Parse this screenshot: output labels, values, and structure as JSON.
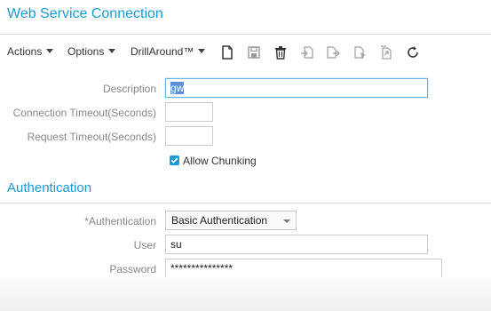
{
  "page": {
    "title": "Web Service Connection"
  },
  "toolbar": {
    "actions_label": "Actions",
    "options_label": "Options",
    "drillaround_label": "DrillAround™",
    "icons": [
      "new-document-icon",
      "save-icon",
      "delete-icon",
      "import-icon",
      "export-icon",
      "select-icon",
      "copy-icon",
      "refresh-icon"
    ]
  },
  "form": {
    "description_label": "Description",
    "description_value": "gw",
    "connection_timeout_label": "Connection Timeout(Seconds)",
    "connection_timeout_value": "",
    "request_timeout_label": "Request Timeout(Seconds)",
    "request_timeout_value": "",
    "allow_chunking_label": "Allow Chunking",
    "allow_chunking_checked": true
  },
  "authentication": {
    "section_title": "Authentication",
    "auth_label": "*Authentication",
    "auth_value": "Basic Authentication",
    "user_label": "User",
    "user_value": "su",
    "password_label": "Password",
    "password_value": "***************"
  },
  "colors": {
    "accent": "#1a9ad6",
    "label": "#888888",
    "border": "#cccccc"
  }
}
